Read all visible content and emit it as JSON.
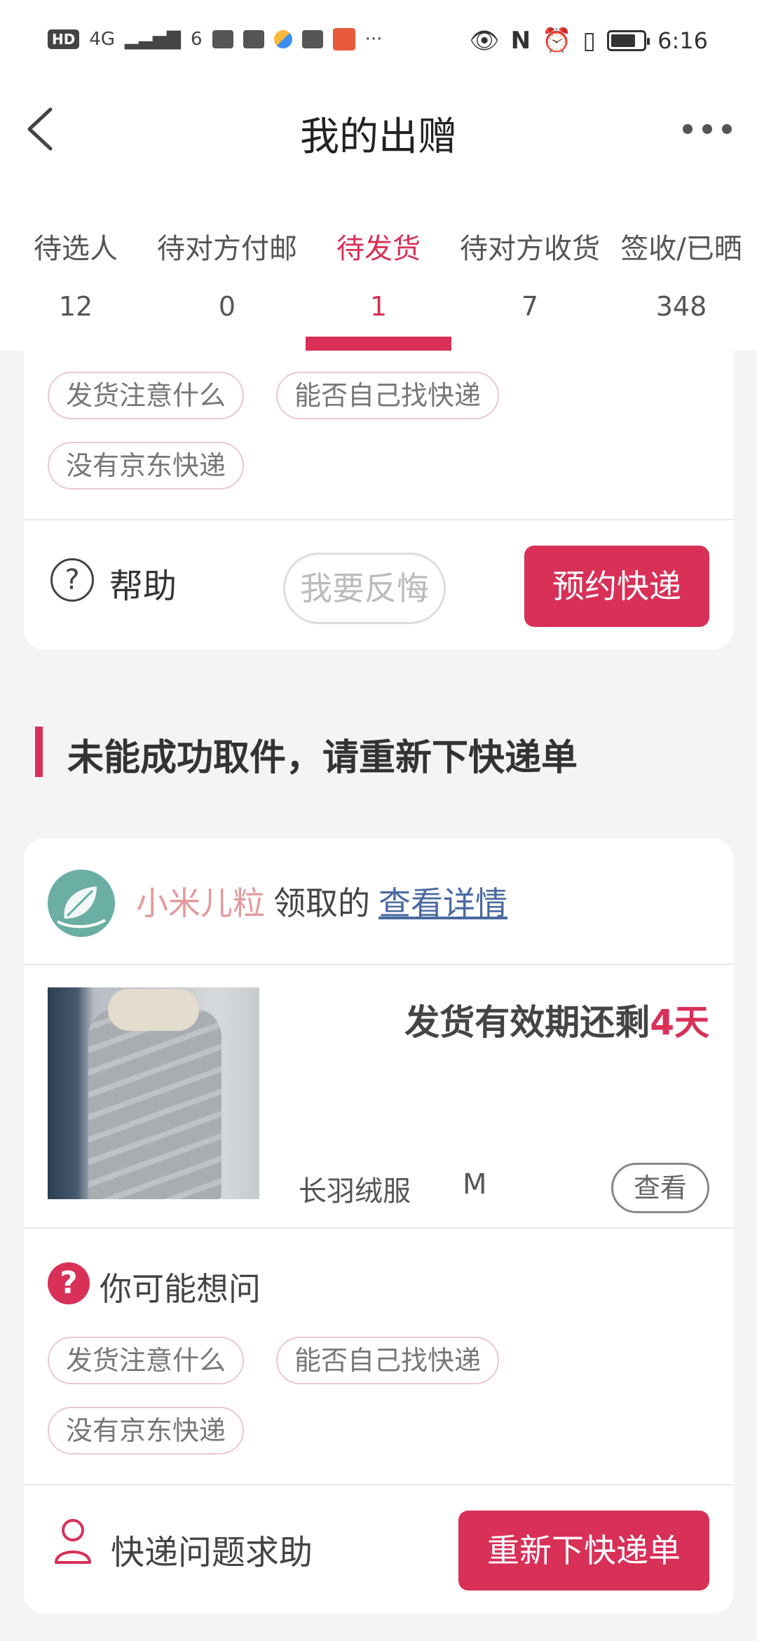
{
  "status_bar": {
    "hd": "HD",
    "net": "4G",
    "wifi_num": "6",
    "more": "···",
    "time": "6:16"
  },
  "header": {
    "title": "我的出赠"
  },
  "tabs": [
    {
      "label": "待选人",
      "count": "12"
    },
    {
      "label": "待对方付邮",
      "count": "0"
    },
    {
      "label": "待发货",
      "count": "1"
    },
    {
      "label": "待对方收货",
      "count": "7"
    },
    {
      "label": "签收/已晒",
      "count": "348"
    }
  ],
  "top_card": {
    "chips": [
      "发货注意什么",
      "能否自己找快递",
      "没有京东快递"
    ],
    "help_icon_glyph": "?",
    "help_label": "帮助",
    "regret_label": "我要反悔",
    "book_label": "预约快递"
  },
  "section": {
    "title": "未能成功取件，请重新下快递单"
  },
  "main_card": {
    "donor_name": "小米儿粒",
    "donor_text": "领取的",
    "donor_link": "查看详情",
    "expiry_prefix": "发货有效期还剩",
    "expiry_days": "4天",
    "product_name": "长羽绒服",
    "product_size": "M",
    "view_label": "查看",
    "faq_icon_glyph": "?",
    "faq_title": "你可能想问",
    "chips": [
      "发货注意什么",
      "能否自己找快递",
      "没有京东快递"
    ],
    "support_label": "快递问题求助",
    "rebook_label": "重新下快递单"
  },
  "colors": {
    "accent": "#d83057",
    "donor_name": "#e39a9c",
    "link": "#4a6aa0",
    "background": "#f4f4f4"
  },
  "icons": [
    "back-arrow-icon",
    "more-dots-icon",
    "help-circle-icon",
    "question-badge-icon",
    "person-icon",
    "battery-icon"
  ]
}
